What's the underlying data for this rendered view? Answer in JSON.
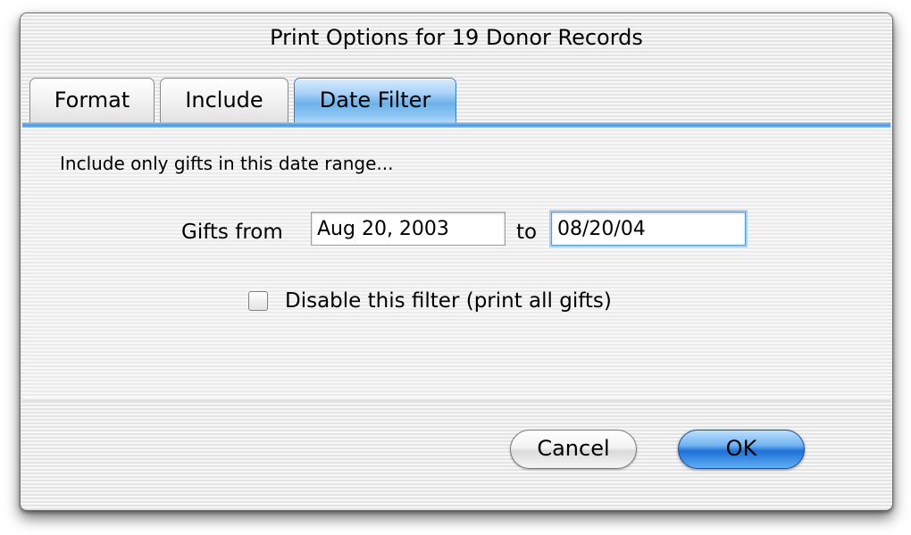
{
  "dialog": {
    "title": "Print Options for 19 Donor Records"
  },
  "tabs": [
    {
      "label": "Format",
      "active": false
    },
    {
      "label": "Include",
      "active": false
    },
    {
      "label": "Date Filter",
      "active": true
    }
  ],
  "date_filter": {
    "intro": "Include only gifts in this date range...",
    "from_label": "Gifts from",
    "from_value": "Aug 20, 2003",
    "to_label": "to",
    "to_value": "08/20/04",
    "disable_label": "Disable this filter (print all gifts)",
    "disable_checked": false
  },
  "buttons": {
    "cancel": "Cancel",
    "ok": "OK"
  },
  "colors": {
    "accent": "#4a95dc",
    "default_button": "#1f6fd8"
  }
}
